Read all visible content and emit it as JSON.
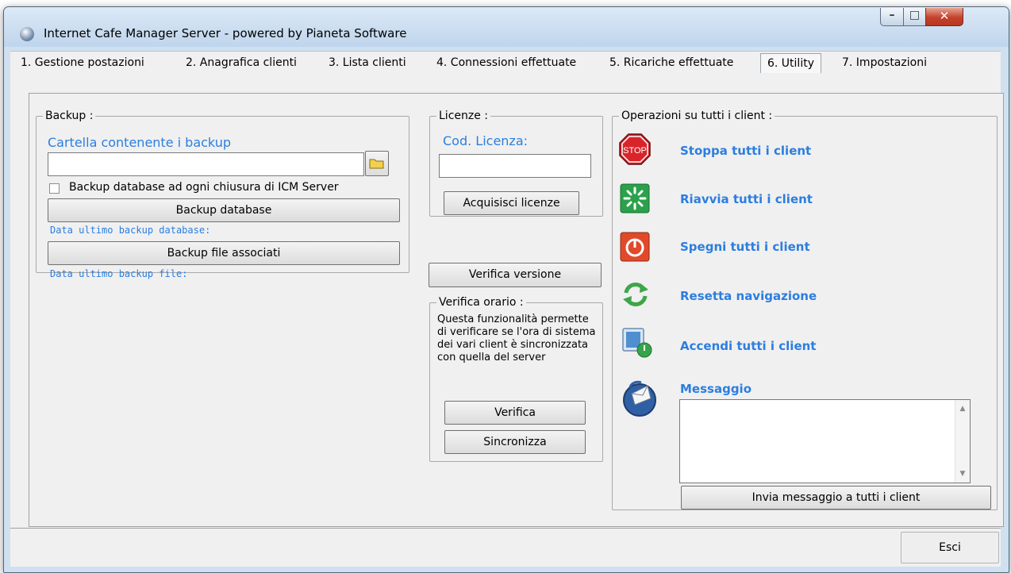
{
  "window": {
    "title": "Internet Cafe Manager Server - powered by Pianeta Software",
    "minimize_glyph": "–",
    "maximize_glyph": "□",
    "close_glyph": "✕"
  },
  "tabs": [
    {
      "label": "1. Gestione postazioni"
    },
    {
      "label": "2. Anagrafica clienti"
    },
    {
      "label": "3. Lista clienti"
    },
    {
      "label": "4. Connessioni effettuate"
    },
    {
      "label": "5. Ricariche effettuate"
    },
    {
      "label": "6. Utility"
    },
    {
      "label": "7. Impostazioni"
    }
  ],
  "backup": {
    "legend": "Backup :",
    "folder_label": "Cartella contenente i backup",
    "folder_value": "",
    "auto_backup_label": "Backup database ad ogni chiusura di ICM Server",
    "auto_backup_checked": false,
    "backup_db_button": "Backup database",
    "last_db_backup_label": "Data ultimo backup database:",
    "backup_files_button": "Backup file associati",
    "last_file_backup_label": "Data ultimo backup file:"
  },
  "licenze": {
    "legend": "Licenze :",
    "code_label": "Cod. Licenza:",
    "code_value": "",
    "acquire_button": "Acquisisci licenze"
  },
  "verifica_versione_button": "Verifica versione",
  "verifica_orario": {
    "legend": "Verifica orario :",
    "description": "Questa funzionalità permette di verificare se l'ora di sistema dei vari client è sincronizzata con quella del server",
    "verify_button": "Verifica",
    "sync_button": "Sincronizza"
  },
  "operazioni": {
    "legend": "Operazioni su tutti i client :",
    "items": [
      {
        "label": "Stoppa tutti i client",
        "icon": "stop-icon"
      },
      {
        "label": "Riavvia tutti i client",
        "icon": "restart-icon"
      },
      {
        "label": "Spegni tutti i client",
        "icon": "power-icon"
      },
      {
        "label": "Resetta navigazione",
        "icon": "refresh-icon"
      },
      {
        "label": "Accendi tutti i client",
        "icon": "power-on-monitor-icon"
      }
    ],
    "message_label": "Messaggio",
    "message_value": "",
    "send_button": "Invia messaggio a tutti i client",
    "stop_text": "STOP"
  },
  "exit_button": "Esci",
  "colors": {
    "accent_blue": "#2b7ee0",
    "stop_red": "#d8242a",
    "restart_green": "#2aa14a",
    "power_red": "#e04a2a"
  }
}
